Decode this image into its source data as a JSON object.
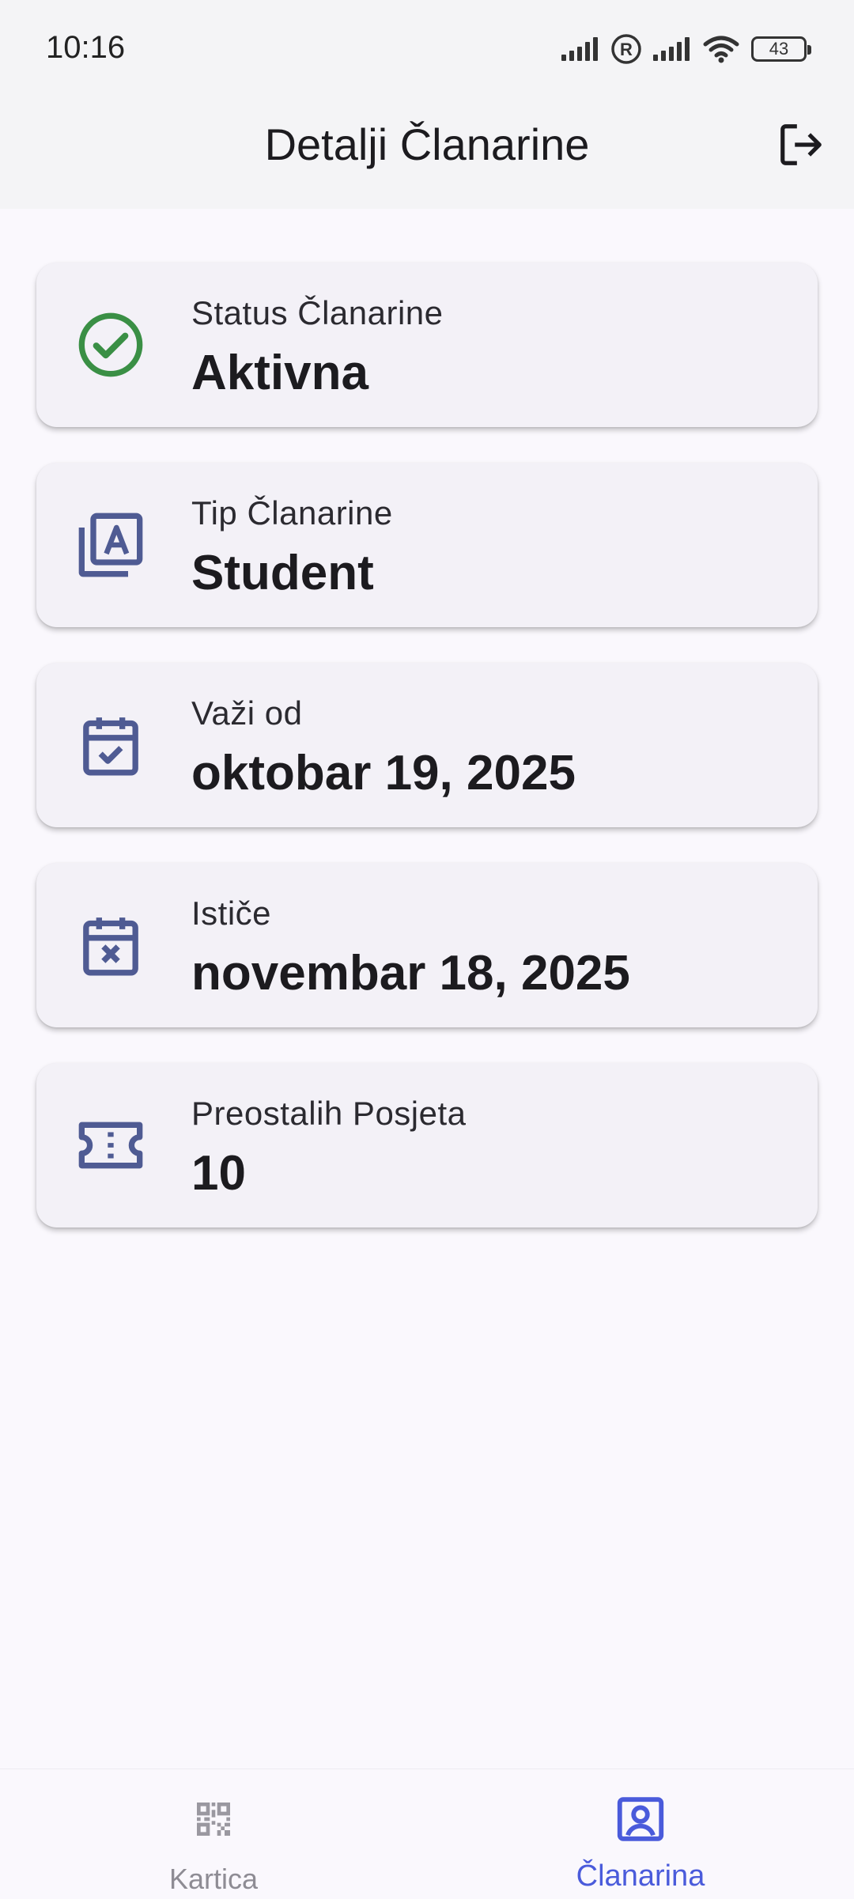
{
  "status_bar": {
    "time": "10:16",
    "battery": "43"
  },
  "app_bar": {
    "title": "Detalji Članarine",
    "logout_icon": "logout-icon"
  },
  "cards": [
    {
      "icon": "check-circle-icon",
      "label": "Status Članarine",
      "value": "Aktivna",
      "icon_color": "#3A8F45"
    },
    {
      "icon": "membership-type-icon",
      "label": "Tip Članarine",
      "value": "Student",
      "icon_color": "#4F5B93"
    },
    {
      "icon": "calendar-check-icon",
      "label": "Važi od",
      "value": "oktobar 19, 2025",
      "icon_color": "#4F5B93"
    },
    {
      "icon": "calendar-x-icon",
      "label": "Ističe",
      "value": "novembar 18, 2025",
      "icon_color": "#4F5B93"
    },
    {
      "icon": "ticket-icon",
      "label": "Preostalih Posjeta",
      "value": "10",
      "icon_color": "#4F5B93"
    }
  ],
  "bottom_nav": {
    "items": [
      {
        "label": "Kartica",
        "icon": "qr-code-icon",
        "selected": false
      },
      {
        "label": "Članarina",
        "icon": "account-box-icon",
        "selected": true
      }
    ],
    "selected_color": "#4A5BDB",
    "unselected_color": "#8E8C94"
  }
}
